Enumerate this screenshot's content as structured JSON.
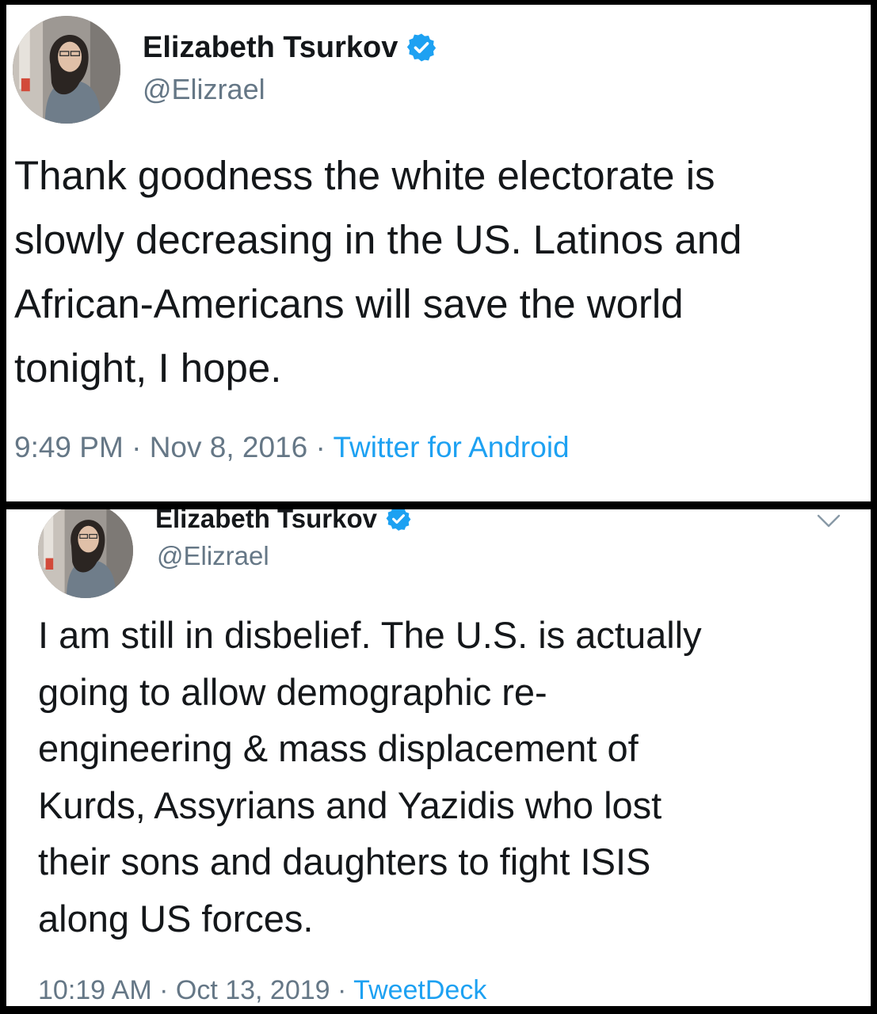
{
  "tweets": [
    {
      "author_name": "Elizabeth Tsurkov",
      "handle": "@Elizrael",
      "text": "Thank goodness the white electorate is\nslowly decreasing in the US. Latinos and\nAfrican-Americans will save the world\ntonight, I hope.",
      "time": "9:49 PM",
      "date": "Nov 8, 2016",
      "separator": " · ",
      "source": "Twitter for Android"
    },
    {
      "author_name": "Elizabeth Tsurkov",
      "handle": "@Elizrael",
      "text": "I am still in disbelief. The U.S. is actually\ngoing to allow demographic re-\nengineering & mass displacement of\nKurds, Assyrians and Yazidis who lost\ntheir sons and daughters to fight ISIS\nalong US forces.",
      "time": "10:19 AM",
      "date": "Oct 13, 2019",
      "separator": " · ",
      "source": "TweetDeck"
    }
  ],
  "icons": {
    "verified": "verified-badge-icon",
    "caret": "chevron-down-icon"
  },
  "colors": {
    "text": "#14171a",
    "secondary": "#657786",
    "link": "#1da1f2",
    "verified": "#1da1f2",
    "frame": "#000000"
  }
}
